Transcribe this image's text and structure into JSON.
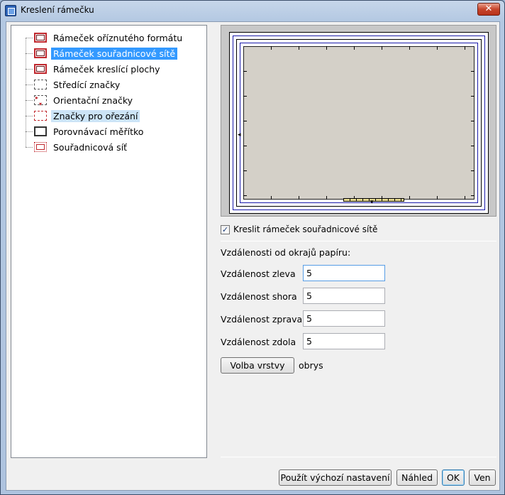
{
  "window": {
    "title": "Kreslení rámečku",
    "close_symbol": "✕"
  },
  "tree": {
    "items": [
      {
        "label": "Rámeček oříznutého formátu",
        "icon": "frame-red-icon",
        "state": "normal"
      },
      {
        "label": "Rámeček souřadnicové sítě",
        "icon": "frame-red-icon",
        "state": "selected"
      },
      {
        "label": "Rámeček kreslící plochy",
        "icon": "frame-red-icon",
        "state": "normal"
      },
      {
        "label": "Středící značky",
        "icon": "center-marks-icon",
        "state": "normal"
      },
      {
        "label": "Orientační značky",
        "icon": "orientation-marks-icon",
        "state": "normal"
      },
      {
        "label": "Značky pro ořezání",
        "icon": "crop-marks-icon",
        "state": "hover"
      },
      {
        "label": "Porovnávací měřítko",
        "icon": "scale-icon",
        "state": "normal"
      },
      {
        "label": "Souřadnicová síť",
        "icon": "grid-icon",
        "state": "normal"
      }
    ]
  },
  "options": {
    "draw_frame_label": "Kreslit rámeček souřadnicové sítě",
    "draw_frame_checked": true,
    "check_mark": "✓",
    "distances_label": "Vzdálenosti od okrajů papíru:",
    "fields": [
      {
        "label": "Vzdálenost zleva",
        "value": "5"
      },
      {
        "label": "Vzdálenost shora",
        "value": "5"
      },
      {
        "label": "Vzdálenost zprava",
        "value": "5"
      },
      {
        "label": "Vzdálenost zdola",
        "value": "5"
      }
    ],
    "layer_button": "Volba vrstvy",
    "layer_value": "obrys"
  },
  "footer": {
    "defaults_button": "Použít výchozí nastavení",
    "preview_button": "Náhled",
    "ok_button": "OK",
    "cancel_button": "Ven"
  }
}
